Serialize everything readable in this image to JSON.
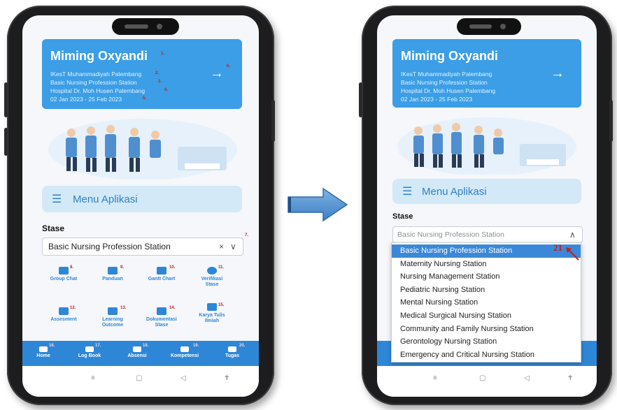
{
  "before": {
    "profile": {
      "name": "Miming Oxyandi",
      "lines": [
        "IKesT Muhammadiyah Palembang",
        "Basic Nursing Profession Station",
        "Hospital Dr. Moh Husen Palembang",
        "02 Jan 2023 - 25 Feb 2023"
      ],
      "logout_icon": "→",
      "markers": [
        "1.",
        "2.",
        "3.",
        "4.",
        "5.",
        "6."
      ]
    },
    "menu": {
      "icon": "☰",
      "title": "Menu Aplikasi"
    },
    "stase": {
      "label": "Stase",
      "selected": "Basic Nursing Profession Station",
      "clear": "×",
      "chevron": "∨",
      "marker": "7."
    },
    "grid": [
      {
        "label": "Group Chat",
        "marker": "8."
      },
      {
        "label": "Panduan",
        "marker": "9."
      },
      {
        "label": "Gantt Chart",
        "marker": "10."
      },
      {
        "label": "Verifikasi Stase",
        "marker": "11."
      },
      {
        "label": "Assesment",
        "marker": "12."
      },
      {
        "label": "Learning Outcome",
        "marker": "13."
      },
      {
        "label": "Dokumentasi Stase",
        "marker": "14."
      },
      {
        "label": "Karya Tulis Ilmiah",
        "marker": "15."
      }
    ],
    "bottom_nav": [
      {
        "label": "Home",
        "marker": "16."
      },
      {
        "label": "Log Book",
        "marker": "17."
      },
      {
        "label": "Absensi",
        "marker": "18."
      },
      {
        "label": "Kompetensi",
        "marker": "19."
      },
      {
        "label": "Tugas",
        "marker": "20."
      }
    ],
    "system_nav": [
      "≡",
      "▢",
      "◁",
      "✝"
    ]
  },
  "after": {
    "profile": {
      "name": "Miming Oxyandi",
      "lines": [
        "IKesT Muhammadiyah Palembang",
        "Basic Nursing Profession Station",
        "Hospital Dr. Moh Husen Palembang",
        "02 Jan 2023 - 25 Feb 2023"
      ],
      "logout_icon": "→"
    },
    "menu": {
      "icon": "☰",
      "title": "Menu Aplikasi"
    },
    "stase": {
      "label": "Stase",
      "selected": "Basic Nursing Profession Station",
      "chevron": "∧"
    },
    "dropdown_options": [
      "Basic Nursing Profession Station",
      "Maternity Nursing Station",
      "Nursing Management Station",
      "Pediatric Nursing Station",
      "Mental Nursing Station",
      "Medical Surgical Nursing Station",
      "Community and Family Nursing Station",
      "Gerontology Nursing Station",
      "Emergency and Critical Nursing Station"
    ],
    "annotation": "21",
    "system_nav": [
      "≡",
      "▢",
      "◁",
      "✝"
    ]
  },
  "colors": {
    "header_blue": "#3b9ee6",
    "primary_blue": "#2e87d6",
    "menu_bg": "#d3e9f8",
    "selected_option": "#3c88d8",
    "marker_red": "#c21f1f"
  }
}
